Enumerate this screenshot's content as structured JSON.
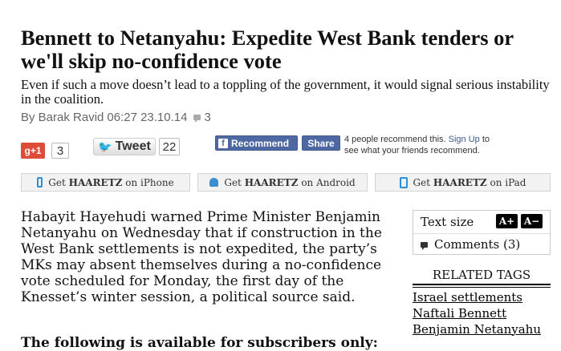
{
  "article": {
    "headline": "Bennett to Netanyahu: Expedite West Bank tenders or we'll skip no-confidence vote",
    "subheadline": "Even if such a move doesn’t lead to a toppling of the government, it would signal serious instability in the coalition.",
    "byline": {
      "author": "By Barak Ravid",
      "datetime": "06:27 23.10.14",
      "comment_count": "3"
    },
    "body_first_paragraph": "Habayit Hayehudi warned Prime Minister Benjamin Netanyahu on Wednesday that if construction in the West Bank settlements is not expedited, the party’s MKs may absent themselves during a no-confidence vote scheduled for Monday, the first day of the Knesset’s winter session, a political source said.",
    "body_second_paragraph_partial": "The following is available for subscribers only:"
  },
  "social": {
    "gplus_label": "g+1",
    "gplus_count": "3",
    "tweet_label": "Tweet",
    "tweet_count": "22",
    "fb_recommend_label": "Recommend",
    "fb_share_label": "Share",
    "fb_text_before": "4 people recommend this. ",
    "fb_signup_link": "Sign Up",
    "fb_text_after": " to see what your friends recommend."
  },
  "app_links": {
    "prefix": "Get",
    "iphone": {
      "brand": "HAARETZ",
      "suffix": "on iPhone"
    },
    "android": {
      "brand": "HAARETZ",
      "suffix": "on Android"
    },
    "ipad": {
      "brand": "HAARETZ",
      "suffix": "on iPad"
    }
  },
  "sidebar": {
    "text_size_label": "Text size",
    "increase_label": "A+",
    "decrease_label": "A−",
    "comments_label": "Comments (3)",
    "related_tags_title": "RELATED TAGS",
    "tags": [
      "Israel settlements",
      "Naftali Bennett",
      "Benjamin Netanyahu"
    ]
  },
  "colors": {
    "gplus": "#dd4b39",
    "facebook": "#4e69a2",
    "twitter_bird": "#2ea1d4",
    "app_icon": "#2a8fd4",
    "byline_gray": "#666666"
  },
  "icons": [
    "google-plus-icon",
    "twitter-bird-icon",
    "facebook-f-icon",
    "iphone-icon",
    "android-icon",
    "ipad-icon",
    "comment-bubble-icon"
  ]
}
